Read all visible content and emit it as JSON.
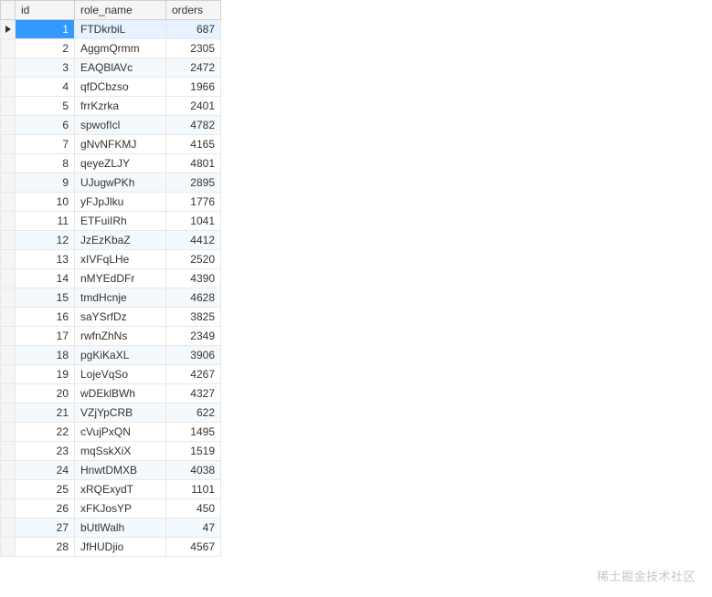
{
  "columns": {
    "id": "id",
    "role_name": "role_name",
    "orders": "orders"
  },
  "rows": [
    {
      "id": "1",
      "role_name": "FTDkrbiL",
      "orders": "687"
    },
    {
      "id": "2",
      "role_name": "AggmQrmm",
      "orders": "2305"
    },
    {
      "id": "3",
      "role_name": "EAQBlAVc",
      "orders": "2472"
    },
    {
      "id": "4",
      "role_name": "qfDCbzso",
      "orders": "1966"
    },
    {
      "id": "5",
      "role_name": "frrKzrka",
      "orders": "2401"
    },
    {
      "id": "6",
      "role_name": "spwofIcl",
      "orders": "4782"
    },
    {
      "id": "7",
      "role_name": "gNvNFKMJ",
      "orders": "4165"
    },
    {
      "id": "8",
      "role_name": "qeyeZLJY",
      "orders": "4801"
    },
    {
      "id": "9",
      "role_name": "UJugwPKh",
      "orders": "2895"
    },
    {
      "id": "10",
      "role_name": "yFJpJlku",
      "orders": "1776"
    },
    {
      "id": "11",
      "role_name": "ETFuiIRh",
      "orders": "1041"
    },
    {
      "id": "12",
      "role_name": "JzEzKbaZ",
      "orders": "4412"
    },
    {
      "id": "13",
      "role_name": "xIVFqLHe",
      "orders": "2520"
    },
    {
      "id": "14",
      "role_name": "nMYEdDFr",
      "orders": "4390"
    },
    {
      "id": "15",
      "role_name": "tmdHcnje",
      "orders": "4628"
    },
    {
      "id": "16",
      "role_name": "saYSrfDz",
      "orders": "3825"
    },
    {
      "id": "17",
      "role_name": "rwfnZhNs",
      "orders": "2349"
    },
    {
      "id": "18",
      "role_name": "pgKiKaXL",
      "orders": "3906"
    },
    {
      "id": "19",
      "role_name": "LojeVqSo",
      "orders": "4267"
    },
    {
      "id": "20",
      "role_name": "wDEklBWh",
      "orders": "4327"
    },
    {
      "id": "21",
      "role_name": "VZjYpCRB",
      "orders": "622"
    },
    {
      "id": "22",
      "role_name": "cVujPxQN",
      "orders": "1495"
    },
    {
      "id": "23",
      "role_name": "mqSskXiX",
      "orders": "1519"
    },
    {
      "id": "24",
      "role_name": "HnwtDMXB",
      "orders": "4038"
    },
    {
      "id": "25",
      "role_name": "xRQExydT",
      "orders": "1101"
    },
    {
      "id": "26",
      "role_name": "xFKJosYP",
      "orders": "450"
    },
    {
      "id": "27",
      "role_name": "bUtlWalh",
      "orders": "47"
    },
    {
      "id": "28",
      "role_name": "JfHUDjio",
      "orders": "4567"
    }
  ],
  "selected_row_index": 0,
  "watermark": "稀土掘金技术社区"
}
